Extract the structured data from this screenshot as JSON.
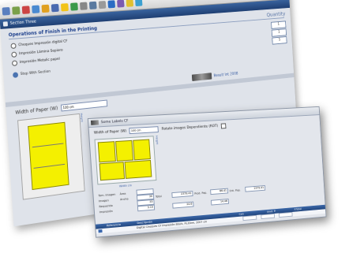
{
  "back_window": {
    "title": "Section Three",
    "section_title": "Operations of Finish in the Printing",
    "quantity_header": "Quantity",
    "options": [
      {
        "label": "Cheques Impresión digital CF",
        "quantity": "1"
      },
      {
        "label": "Impresión Lámina Sepioro",
        "quantity": "1"
      },
      {
        "label": "Impresión Metalic papel",
        "quantity": "1"
      }
    ],
    "step_label": "Step With Section",
    "help_link": "Result Int 2008",
    "width_label": "Width of Paper (W)",
    "width_value": "100 cm",
    "side_ruler": "Height"
  },
  "front_window": {
    "title": "Some Labels CF",
    "width_label": "Width of Paper (W)",
    "width_value": "100 cm",
    "rotate_label": "Rotate Images Dependiente (ROT)",
    "ruler_right": "Height",
    "ruler_bottom": "Width cm",
    "calc": {
      "row1_label": "Tam. Imagen",
      "row1_caption": "Área",
      "row1_value": "",
      "rows": [
        {
          "label": "Imagen",
          "cap1": "Ancho",
          "v1": "30",
          "cap2": "Total",
          "v2": "2379.41",
          "cap3": "Prod. Pap.",
          "v3": "66.41",
          "cap4": "Ent. Pap.",
          "v4": "2379.41"
        },
        {
          "label": "Requerido",
          "cap1": "",
          "v1": "33",
          "cap2": "",
          "v2": "",
          "cap3": "",
          "v3": "",
          "cap4": "",
          "v4": ""
        },
        {
          "label": "Impresión",
          "cap1": "",
          "v1": "3.15",
          "cap2": "",
          "v2": "24.6",
          "cap3": "",
          "v3": "14.46",
          "cap4": "",
          "v4": ""
        }
      ]
    },
    "grid": {
      "headers": [
        "",
        "Referencia",
        "Descripción",
        "Can",
        "Unid. P.",
        "P.Total"
      ],
      "row": {
        "ref": "",
        "desc": "Digital Cheques CF Impresión Block, Ps.Elem, 2007 cm"
      }
    }
  },
  "colors": {
    "accent": "#1f3f73",
    "sheet": "#f4f000",
    "panel": "#dfe3ea"
  }
}
